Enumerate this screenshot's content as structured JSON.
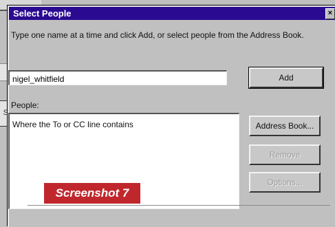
{
  "background": {
    "fragment_label": "S"
  },
  "dialog": {
    "title": "Select People",
    "close_glyph": "×",
    "instructions": "Type one name at a time and click Add, or select people from the Address Book.",
    "name_input_value": "nigel_whitfield",
    "add_label": "Add",
    "people_label": "People:",
    "people_list_item": "Where the To or CC line contains",
    "address_book_label": "Address Book...",
    "remove_label": "Remove",
    "options_label": "Options...",
    "colors": {
      "titlebar": "#2a0a90",
      "face": "#c0c0c0"
    }
  },
  "caption": {
    "text": "Screenshot 7",
    "color": "#c0272d"
  }
}
